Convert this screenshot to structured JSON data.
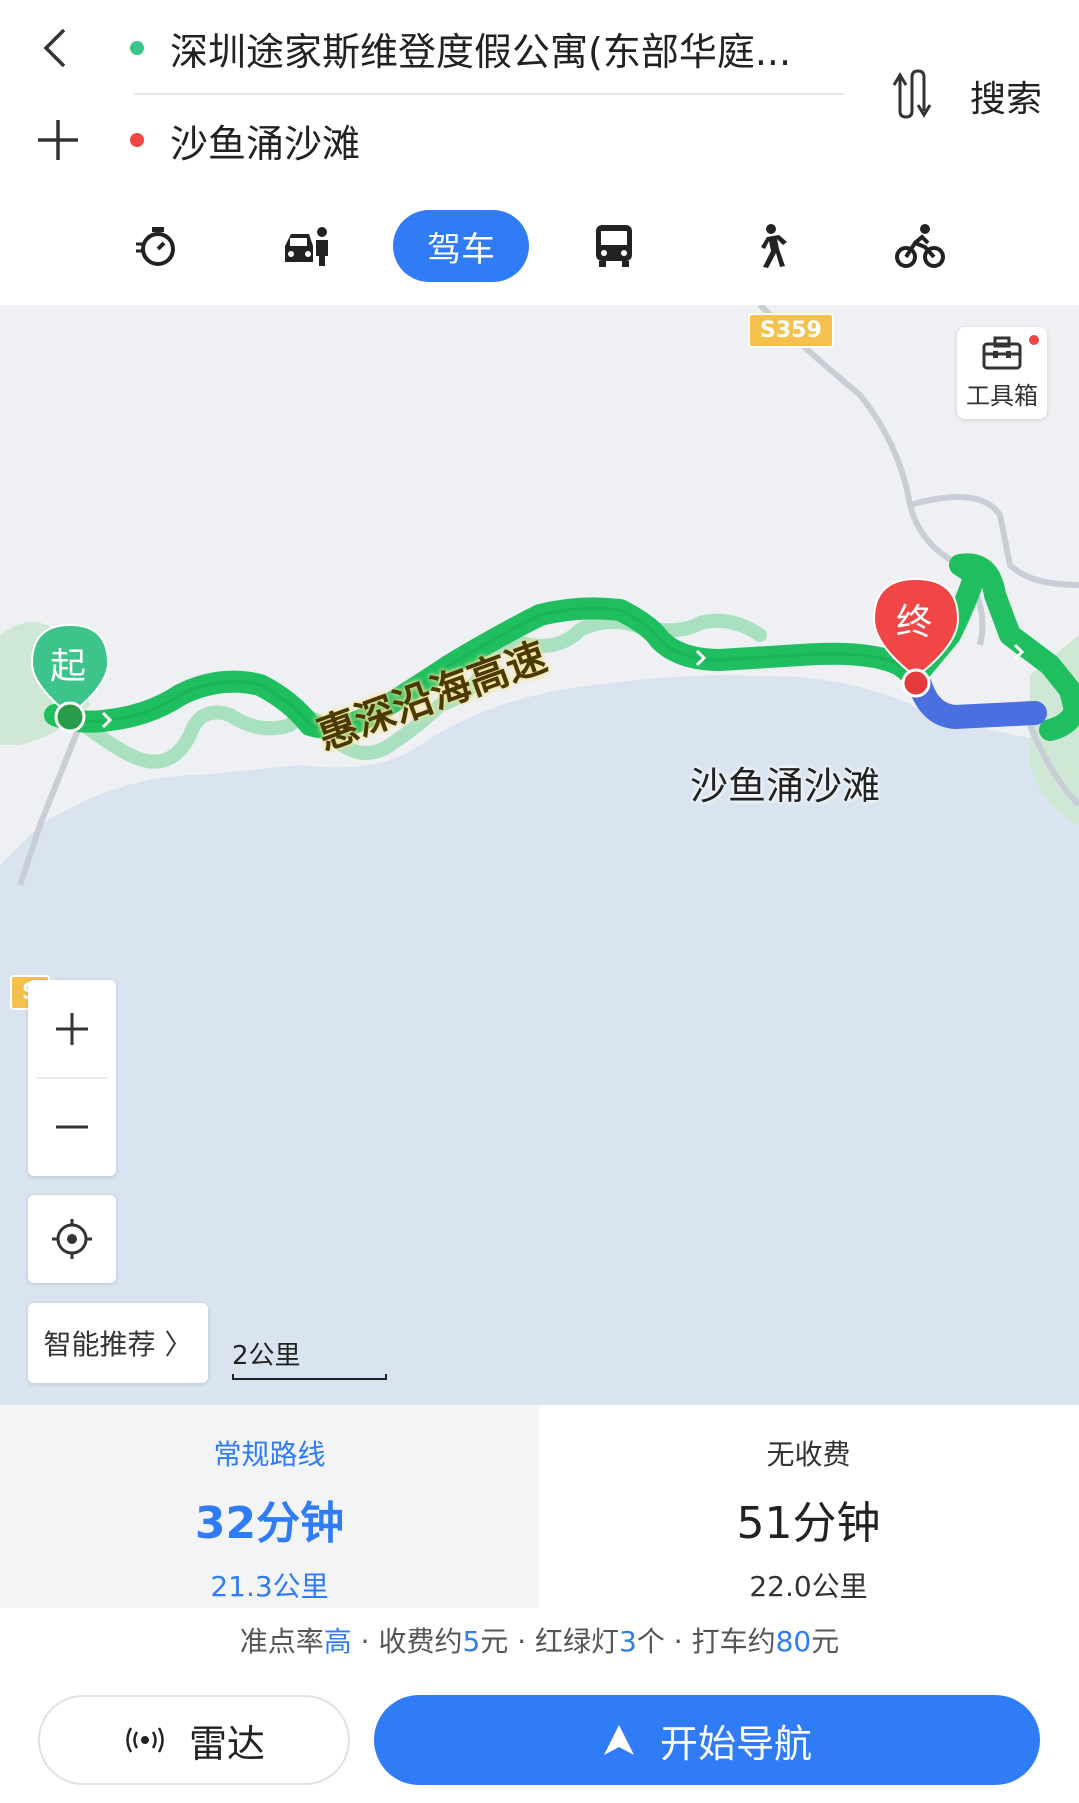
{
  "header": {
    "start_location": "深圳途家斯维登度假公寓(东部华庭...",
    "end_location": "沙鱼涌沙滩",
    "search_label": "搜索"
  },
  "modes": {
    "active_label": "驾车",
    "icons": [
      "timer-icon",
      "car-taxi-icon",
      "bus-icon",
      "walk-icon",
      "bike-icon"
    ]
  },
  "map": {
    "highway_badge": "S359",
    "highway_badge_partial": "S",
    "road_label": "惠深沿海高速",
    "destination_label": "沙鱼涌沙滩",
    "start_marker": "起",
    "end_marker": "终",
    "toolbox_label": "工具箱",
    "smart_recommend_label": "智能推荐 〉",
    "scale_label": "2公里"
  },
  "routes": [
    {
      "name": "常规路线",
      "time": "32分钟",
      "distance": "21.3公里",
      "selected": true
    },
    {
      "name": "无收费",
      "time": "51分钟",
      "distance": "22.0公里",
      "selected": false
    }
  ],
  "summary": {
    "on_time_label": "准点率",
    "on_time_value": "高",
    "sep": " · ",
    "toll_prefix": "收费约",
    "toll_value": "5",
    "toll_suffix": "元",
    "lights_prefix": "红绿灯",
    "lights_value": "3",
    "lights_suffix": "个",
    "taxi_prefix": "打车约",
    "taxi_value": "80",
    "taxi_suffix": "元"
  },
  "buttons": {
    "radar_label": "雷达",
    "start_nav_label": "开始导航"
  },
  "colors": {
    "accent": "#2f7cf6",
    "route_green": "#1fbf5f",
    "alt_route_green": "#9edcb8",
    "start_marker": "#3cc48a",
    "end_marker": "#f04646",
    "sea": "#d9e4f0"
  }
}
